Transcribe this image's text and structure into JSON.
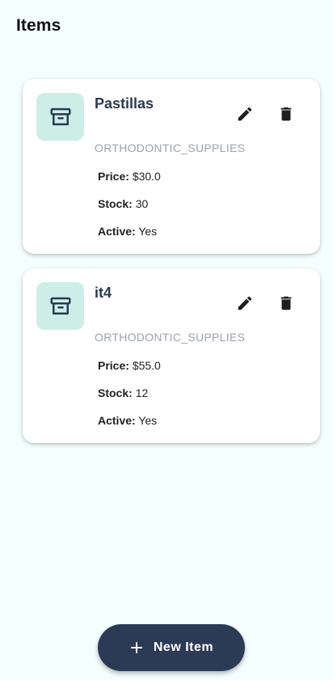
{
  "header": {
    "title": "Items"
  },
  "items": [
    {
      "name": "Pastillas",
      "category": "ORTHODONTIC_SUPPLIES",
      "price_label": "Price:",
      "price": "$30.0",
      "stock_label": "Stock:",
      "stock": "30",
      "active_label": "Active:",
      "active": "Yes",
      "icon": "archive-box-icon"
    },
    {
      "name": "it4",
      "category": "ORTHODONTIC_SUPPLIES",
      "price_label": "Price:",
      "price": "$55.0",
      "stock_label": "Stock:",
      "stock": "12",
      "active_label": "Active:",
      "active": "Yes",
      "icon": "archive-box-icon"
    }
  ],
  "actions": {
    "edit_icon": "pencil-icon",
    "delete_icon": "trash-icon"
  },
  "fab": {
    "label": "New Item",
    "icon": "plus-icon"
  },
  "colors": {
    "background": "#f3fefd",
    "primary": "#2b3a55",
    "thumb_bg": "#cdeee6",
    "muted_text": "#9ca3af"
  }
}
